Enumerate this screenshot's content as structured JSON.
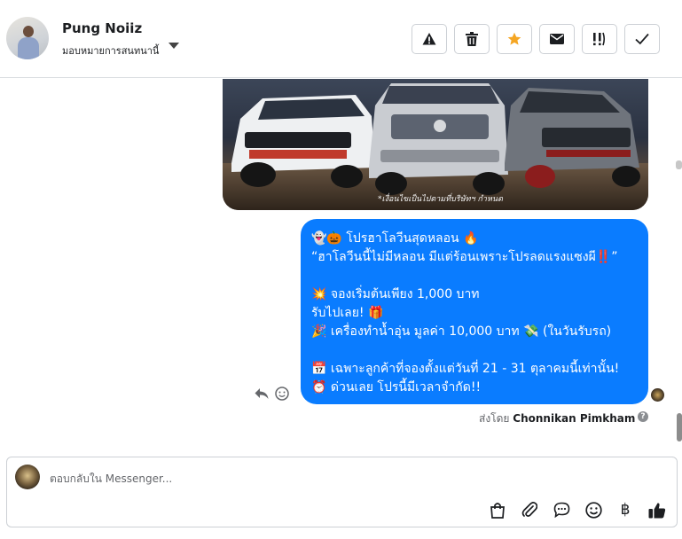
{
  "header": {
    "name": "Pung Noiiz",
    "assign_label": "มอบหมายการสนทนานี้"
  },
  "toolbar": {
    "buttons": [
      {
        "name": "mark-spam-button",
        "icon": "warning-icon"
      },
      {
        "name": "delete-button",
        "icon": "trash-icon"
      },
      {
        "name": "star-button",
        "icon": "star-icon",
        "color": "#f5a623"
      },
      {
        "name": "mark-unread-button",
        "icon": "envelope-icon"
      },
      {
        "name": "follow-up-button",
        "icon": "exclamation-icon"
      },
      {
        "name": "mark-done-button",
        "icon": "check-icon"
      }
    ]
  },
  "chat": {
    "image_caption": "*เงื่อนไขเป็นไปตามที่บริษัทฯ กำหนด",
    "message_lines": [
      "👻🎃 โปรฮาโลวีนสุดหลอน 🔥",
      "“ฮาโลวีนนี้ไม่มีหลอน มีแต่ร้อนเพราะโปรลดแรงแซงผี‼️”",
      "",
      "💥 จองเริ่มต้นเพียง 1,000 บาท",
      "รับไปเลย! 🎁",
      "🎉 เครื่องทำน้ำอุ่น มูลค่า 10,000 บาท 💸 (ในวันรับรถ)",
      "",
      "📅 เฉพาะลูกค้าที่จองตั้งแต่วันที่ 21 - 31 ตุลาคมนี้เท่านั้น!",
      "⏰ ด่วนเลย โปรนี้มีเวลาจำกัด!!"
    ],
    "sent_by_prefix": "ส่งโดย",
    "sent_by_name": "Chonnikan Pimkham",
    "bubble_color": "#0a7cff"
  },
  "composer": {
    "placeholder": "ตอบกลับใน Messenger...",
    "value": "",
    "currency_symbol": "฿",
    "icons": [
      "shopping-bag-icon",
      "paperclip-icon",
      "saved-reply-icon",
      "emoji-icon",
      "baht-icon",
      "thumbs-up-icon"
    ]
  }
}
